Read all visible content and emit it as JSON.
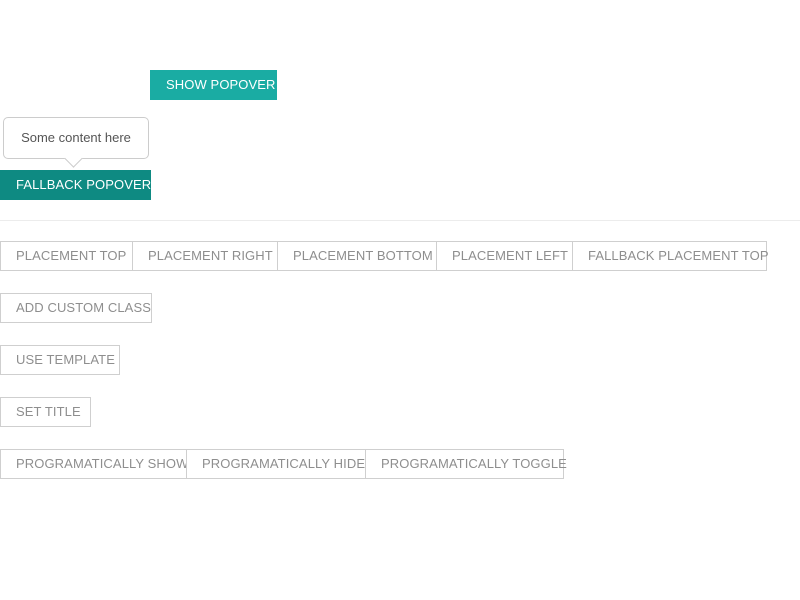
{
  "top": {
    "show_popover_label": "SHOW POPOVER",
    "fallback_popover_label": "FALLBACK POPOVER",
    "popover_content": "Some content here"
  },
  "placement_row": {
    "top_label": "PLACEMENT TOP",
    "right_label": "PLACEMENT RIGHT",
    "bottom_label": "PLACEMENT BOTTOM",
    "left_label": "PLACEMENT LEFT",
    "fallback_top_label": "FALLBACK PLACEMENT TOP"
  },
  "options": {
    "custom_class_label": "ADD CUSTOM CLASS",
    "use_template_label": "USE TEMPLATE",
    "set_title_label": "SET TITLE"
  },
  "programmatic_row": {
    "show_label": "PROGRAMATICALLY SHOW",
    "hide_label": "PROGRAMATICALLY HIDE",
    "toggle_label": "PROGRAMATICALLY TOGGLE"
  },
  "colors": {
    "primary": "#1aaca3",
    "primary_active": "#0e8a82",
    "outline_border": "#cfcfcf",
    "outline_text": "#8e8e8e"
  }
}
